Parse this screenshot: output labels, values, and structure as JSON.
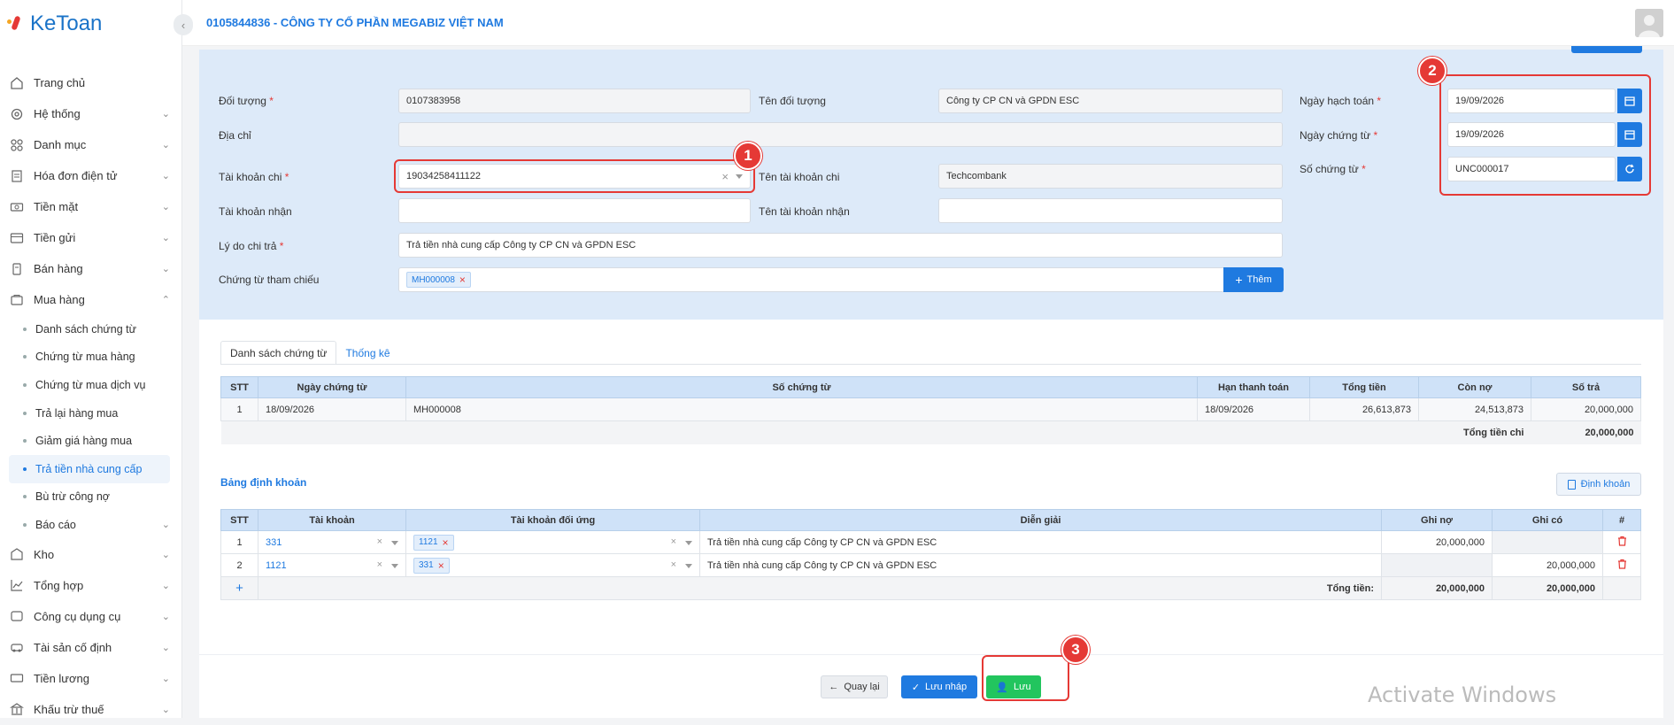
{
  "app": {
    "brand": "KeToan"
  },
  "header": {
    "company": "0105844836 - CÔNG TY CỔ PHẦN MEGABIZ VIỆT NAM"
  },
  "sidebar": {
    "items": [
      {
        "label": "Trang chủ",
        "icon": "home-icon"
      },
      {
        "label": "Hệ thống",
        "icon": "gear-icon"
      },
      {
        "label": "Danh mục",
        "icon": "grid-icon"
      },
      {
        "label": "Hóa đơn điện tử",
        "icon": "invoice-icon"
      },
      {
        "label": "Tiền mặt",
        "icon": "cash-icon"
      },
      {
        "label": "Tiền gửi",
        "icon": "bank-icon"
      },
      {
        "label": "Bán hàng",
        "icon": "sale-icon"
      },
      {
        "label": "Mua hàng",
        "icon": "purchase-icon"
      }
    ],
    "sub_items": [
      "Danh sách chứng từ",
      "Chứng từ mua hàng",
      "Chứng từ mua dịch vụ",
      "Trả lại hàng mua",
      "Giảm giá hàng mua",
      "Trả tiền nhà cung cấp",
      "Bù trừ công nợ",
      "Báo cáo"
    ],
    "items_after": [
      {
        "label": "Kho",
        "icon": "warehouse-icon"
      },
      {
        "label": "Tổng hợp",
        "icon": "chart-icon"
      },
      {
        "label": "Công cụ dụng cụ",
        "icon": "tool-icon"
      },
      {
        "label": "Tài sản cố định",
        "icon": "asset-icon"
      },
      {
        "label": "Tiền lương",
        "icon": "salary-icon"
      },
      {
        "label": "Khấu trừ thuế",
        "icon": "tax-icon"
      }
    ]
  },
  "form": {
    "doi_tuong_label": "Đối tượng",
    "doi_tuong_value": "0107383958",
    "ten_doi_tuong_label": "Tên đối tượng",
    "ten_doi_tuong_value": "Công ty CP CN và GPDN ESC",
    "dia_chi_label": "Địa chỉ",
    "dia_chi_value": "",
    "tk_chi_label": "Tài khoản chi",
    "tk_chi_value": "19034258411122",
    "ten_tk_chi_label": "Tên tài khoản chi",
    "ten_tk_chi_value": "Techcombank",
    "tk_nhan_label": "Tài khoản nhận",
    "tk_nhan_value": "",
    "ten_tk_nhan_label": "Tên tài khoản nhận",
    "ten_tk_nhan_value": "",
    "ly_do_label": "Lý do chi trả",
    "ly_do_value": "Trả tiền nhà cung cấp Công ty CP CN và GPDN ESC",
    "ct_tham_chieu_label": "Chứng từ tham chiếu",
    "ct_tham_chieu_tag": "MH000008",
    "them_label": "Thêm",
    "ngay_hach_toan_label": "Ngày hạch toán",
    "ngay_hach_toan_value": "19/09/2026",
    "ngay_chung_tu_label": "Ngày chứng từ",
    "ngay_chung_tu_value": "19/09/2026",
    "so_chung_tu_label": "Số chứng từ",
    "so_chung_tu_value": "UNC000017",
    "required_mark": "*"
  },
  "annotations": {
    "b1": "1",
    "b2": "2",
    "b3": "3"
  },
  "tabs": {
    "tab1": "Danh sách chứng từ",
    "tab2": "Thống kê"
  },
  "doc_table": {
    "headers": [
      "STT",
      "Ngày chứng từ",
      "Số chứng từ",
      "Hạn thanh toán",
      "Tổng tiền",
      "Còn nợ",
      "Số trả"
    ],
    "rows": [
      [
        "1",
        "18/09/2026",
        "MH000008",
        "18/09/2026",
        "26,613,873",
        "24,513,873",
        "20,000,000"
      ]
    ],
    "total_label": "Tổng tiền chi",
    "total_value": "20,000,000"
  },
  "entry": {
    "title": "Bảng định khoản",
    "dinh_khoan_label": "Định khoản",
    "headers": [
      "STT",
      "Tài khoản",
      "Tài khoản đối ứng",
      "Diễn giải",
      "Ghi nợ",
      "Ghi có",
      "#"
    ],
    "rows": [
      {
        "stt": "1",
        "tk": "331",
        "tk_du": "1121",
        "dien_giai": "Trả tiền nhà cung cấp Công ty CP CN và GPDN ESC",
        "no": "20,000,000",
        "co": ""
      },
      {
        "stt": "2",
        "tk": "1121",
        "tk_du": "331",
        "dien_giai": "Trả tiền nhà cung cấp Công ty CP CN và GPDN ESC",
        "no": "",
        "co": "20,000,000"
      }
    ],
    "add_symbol": "+",
    "total_label": "Tổng tiền:",
    "total_no": "20,000,000",
    "total_co": "20,000,000"
  },
  "actions": {
    "back": "Quay lại",
    "draft": "Lưu nháp",
    "save": "Lưu"
  },
  "watermark": "Activate Windows",
  "colors": {
    "primary": "#1f7ae0",
    "success": "#22c55e",
    "highlight": "#e53935",
    "panel": "#ddeaf9"
  }
}
